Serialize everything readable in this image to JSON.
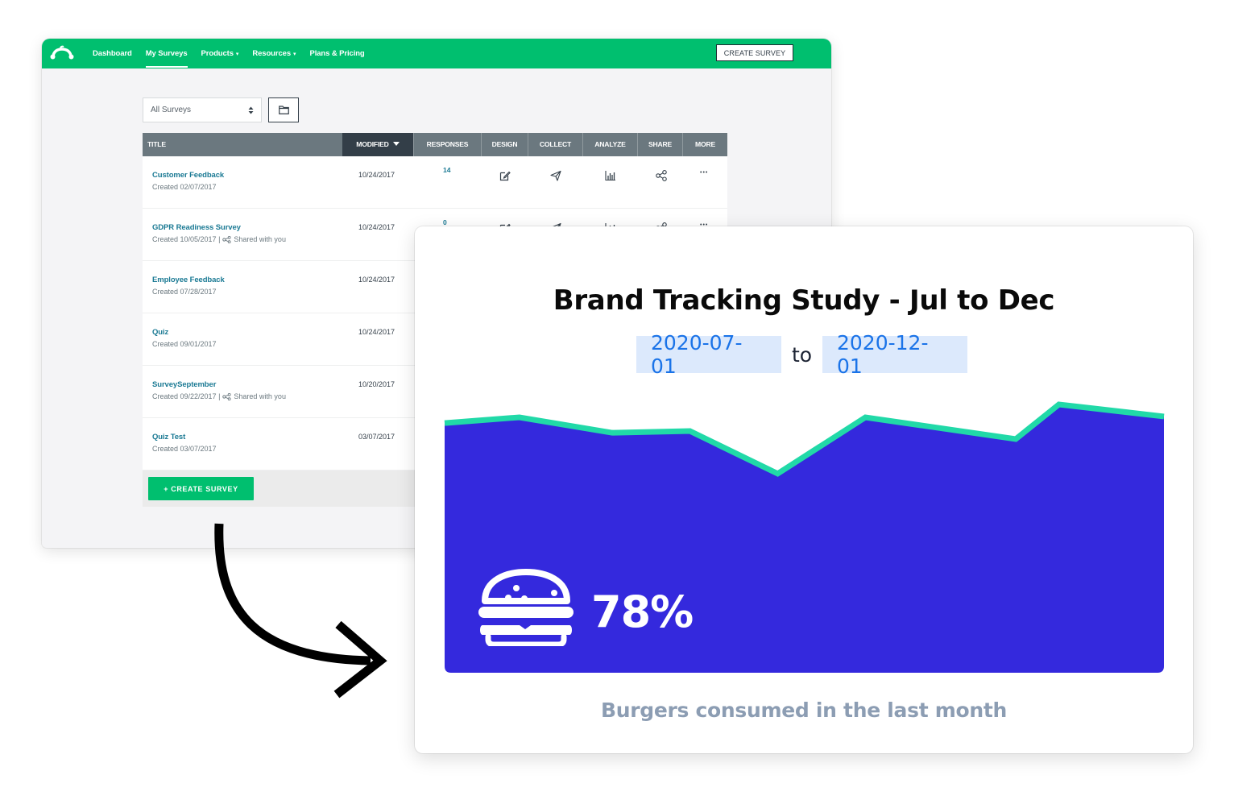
{
  "app": {
    "nav": {
      "items": [
        {
          "label": "Dashboard",
          "active": false,
          "has_caret": false
        },
        {
          "label": "My Surveys",
          "active": true,
          "has_caret": false
        },
        {
          "label": "Products",
          "active": false,
          "has_caret": true
        },
        {
          "label": "Resources",
          "active": false,
          "has_caret": true
        },
        {
          "label": "Plans & Pricing",
          "active": false,
          "has_caret": false
        }
      ],
      "caret_glyph": "▾",
      "create_button": "CREATE SURVEY"
    },
    "filter": {
      "selected": "All Surveys"
    },
    "table": {
      "columns": {
        "title": "TITLE",
        "modified": "MODIFIED",
        "responses": "RESPONSES",
        "design": "DESIGN",
        "collect": "COLLECT",
        "analyze": "ANALYZE",
        "share": "SHARE",
        "more": "MORE"
      },
      "rows": [
        {
          "title": "Customer Feedback",
          "created": "Created 02/07/2017",
          "shared": "",
          "modified": "10/24/2017",
          "responses": "14"
        },
        {
          "title": "GDPR Readiness Survey",
          "created": "Created 10/05/2017 |",
          "shared": "Shared with you",
          "modified": "10/24/2017",
          "responses": "0"
        },
        {
          "title": "Employee Feedback",
          "created": "Created 07/28/2017",
          "shared": "",
          "modified": "10/24/2017",
          "responses": ""
        },
        {
          "title": "Quiz",
          "created": "Created 09/01/2017",
          "shared": "",
          "modified": "10/24/2017",
          "responses": ""
        },
        {
          "title": "SurveySeptember",
          "created": "Created 09/22/2017 |",
          "shared": "Shared with you",
          "modified": "10/20/2017",
          "responses": ""
        },
        {
          "title": "Quiz Test",
          "created": "Created 03/07/2017",
          "shared": "",
          "modified": "03/07/2017",
          "responses": ""
        }
      ],
      "more_glyph": "•••"
    },
    "create_bottom": "+ CREATE SURVEY"
  },
  "dashboard": {
    "title": "Brand Tracking Study - Jul to Dec",
    "date_from": "2020-07-01",
    "date_to": "2020-12-01",
    "date_sep": "to",
    "kpi_value": "78%",
    "kpi_icon": "burger-icon",
    "caption": "Burgers consumed in the last month",
    "colors": {
      "area": "#3429dd",
      "line": "#21d9a8",
      "chip_bg": "#dce9fc",
      "chip_text": "#1a73e8",
      "caption": "#8c9db3"
    }
  },
  "brand_colors": {
    "primary_green": "#00bf6f",
    "header_gray": "#6b787f",
    "header_dark": "#333e48",
    "link": "#1b7a94"
  },
  "chart_data": {
    "type": "area",
    "title": "Brand Tracking Study - Jul to Dec",
    "xlabel": "",
    "ylabel": "",
    "x_range": [
      "2020-07-01",
      "2020-12-01"
    ],
    "x_fraction": [
      0.0,
      0.104,
      0.233,
      0.341,
      0.463,
      0.585,
      0.794,
      0.854,
      1.0
    ],
    "values": [
      87.3,
      89.3,
      83.9,
      84.5,
      69.6,
      89.3,
      81.7,
      93.8,
      89.6
    ],
    "ylim": [
      0,
      100
    ],
    "y_unit": "relative index (no axis shown)",
    "grid": false,
    "legend": "none",
    "annotation": "78%"
  }
}
